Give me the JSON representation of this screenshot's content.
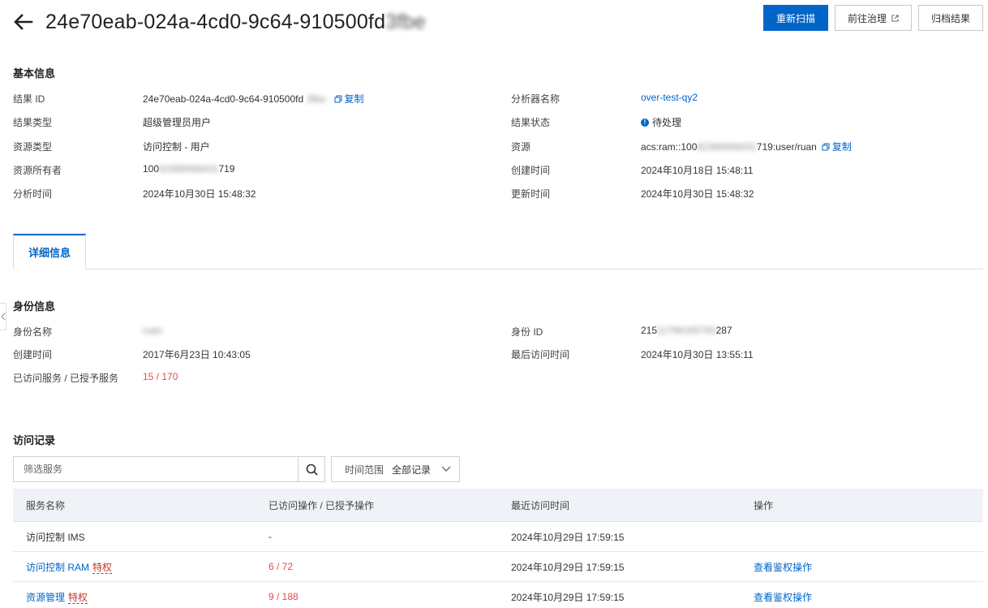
{
  "header": {
    "title_visible": "24e70eab-024a-4cd0-9c64-910500fd",
    "title_blurred": "3fbe"
  },
  "actions": {
    "rescan": "重新扫描",
    "govern": "前往治理",
    "archive": "归档结果"
  },
  "basic": {
    "title": "基本信息",
    "result_id_label": "结果 ID",
    "result_id_value": "24e70eab-024a-4cd0-9c64-910500fd",
    "result_id_blur": "3fbe",
    "copy_label": "复制",
    "result_type_label": "结果类型",
    "result_type_value": "超级管理员用户",
    "resource_type_label": "资源类型",
    "resource_type_value": "访问控制 - 用户",
    "owner_label": "资源所有者",
    "owner_value_start": "100",
    "owner_value_blur": "81589456431",
    "owner_value_end": "719",
    "analyze_time_label": "分析时间",
    "analyze_time_value": "2024年10月30日 15:48:32",
    "analyzer_label": "分析器名称",
    "analyzer_value": "over-test-qy2",
    "status_label": "结果状态",
    "status_value": "待处理",
    "resource_label": "资源",
    "resource_value_start": "acs:ram::100",
    "resource_value_blur": "81589456431",
    "resource_value_end": "719:user/ruan",
    "created_label": "创建时间",
    "created_value": "2024年10月18日 15:48:11",
    "updated_label": "更新时间",
    "updated_value": "2024年10月30日 15:48:32"
  },
  "tabs": {
    "detail": "详细信息"
  },
  "identity": {
    "title": "身份信息",
    "name_label": "身份名称",
    "name_value_blur": "ruan",
    "created_label": "创建时间",
    "created_value": "2017年6月23日 10:43:05",
    "services_label": "已访问服务 / 已授予服务",
    "services_value": "15 / 170",
    "id_label": "身份 ID",
    "id_value_start": "215",
    "id_value_blur": "11796165783",
    "id_value_end": "287",
    "last_access_label": "最后访问时间",
    "last_access_value": "2024年10月30日 13:55:11"
  },
  "access": {
    "title": "访问记录",
    "search_placeholder": "筛选服务",
    "time_range_label": "时间范围",
    "time_range_value": "全部记录",
    "columns": [
      "服务名称",
      "已访问操作 / 已授予操作",
      "最近访问时间",
      "操作"
    ],
    "rows": [
      {
        "service": "访问控制 IMS",
        "privilege": "",
        "ops": "-",
        "time": "2024年10月29日 17:59:15",
        "action": ""
      },
      {
        "service": "访问控制 RAM",
        "privilege": "特权",
        "ops": "6 / 72",
        "time": "2024年10月29日 17:59:15",
        "action": "查看鉴权操作"
      },
      {
        "service": "资源管理",
        "privilege": "特权",
        "ops": "9 / 188",
        "time": "2024年10月29日 17:59:15",
        "action": "查看鉴权操作"
      }
    ]
  },
  "colors": {
    "primary": "#0064c8",
    "danger": "#e34d4d"
  }
}
